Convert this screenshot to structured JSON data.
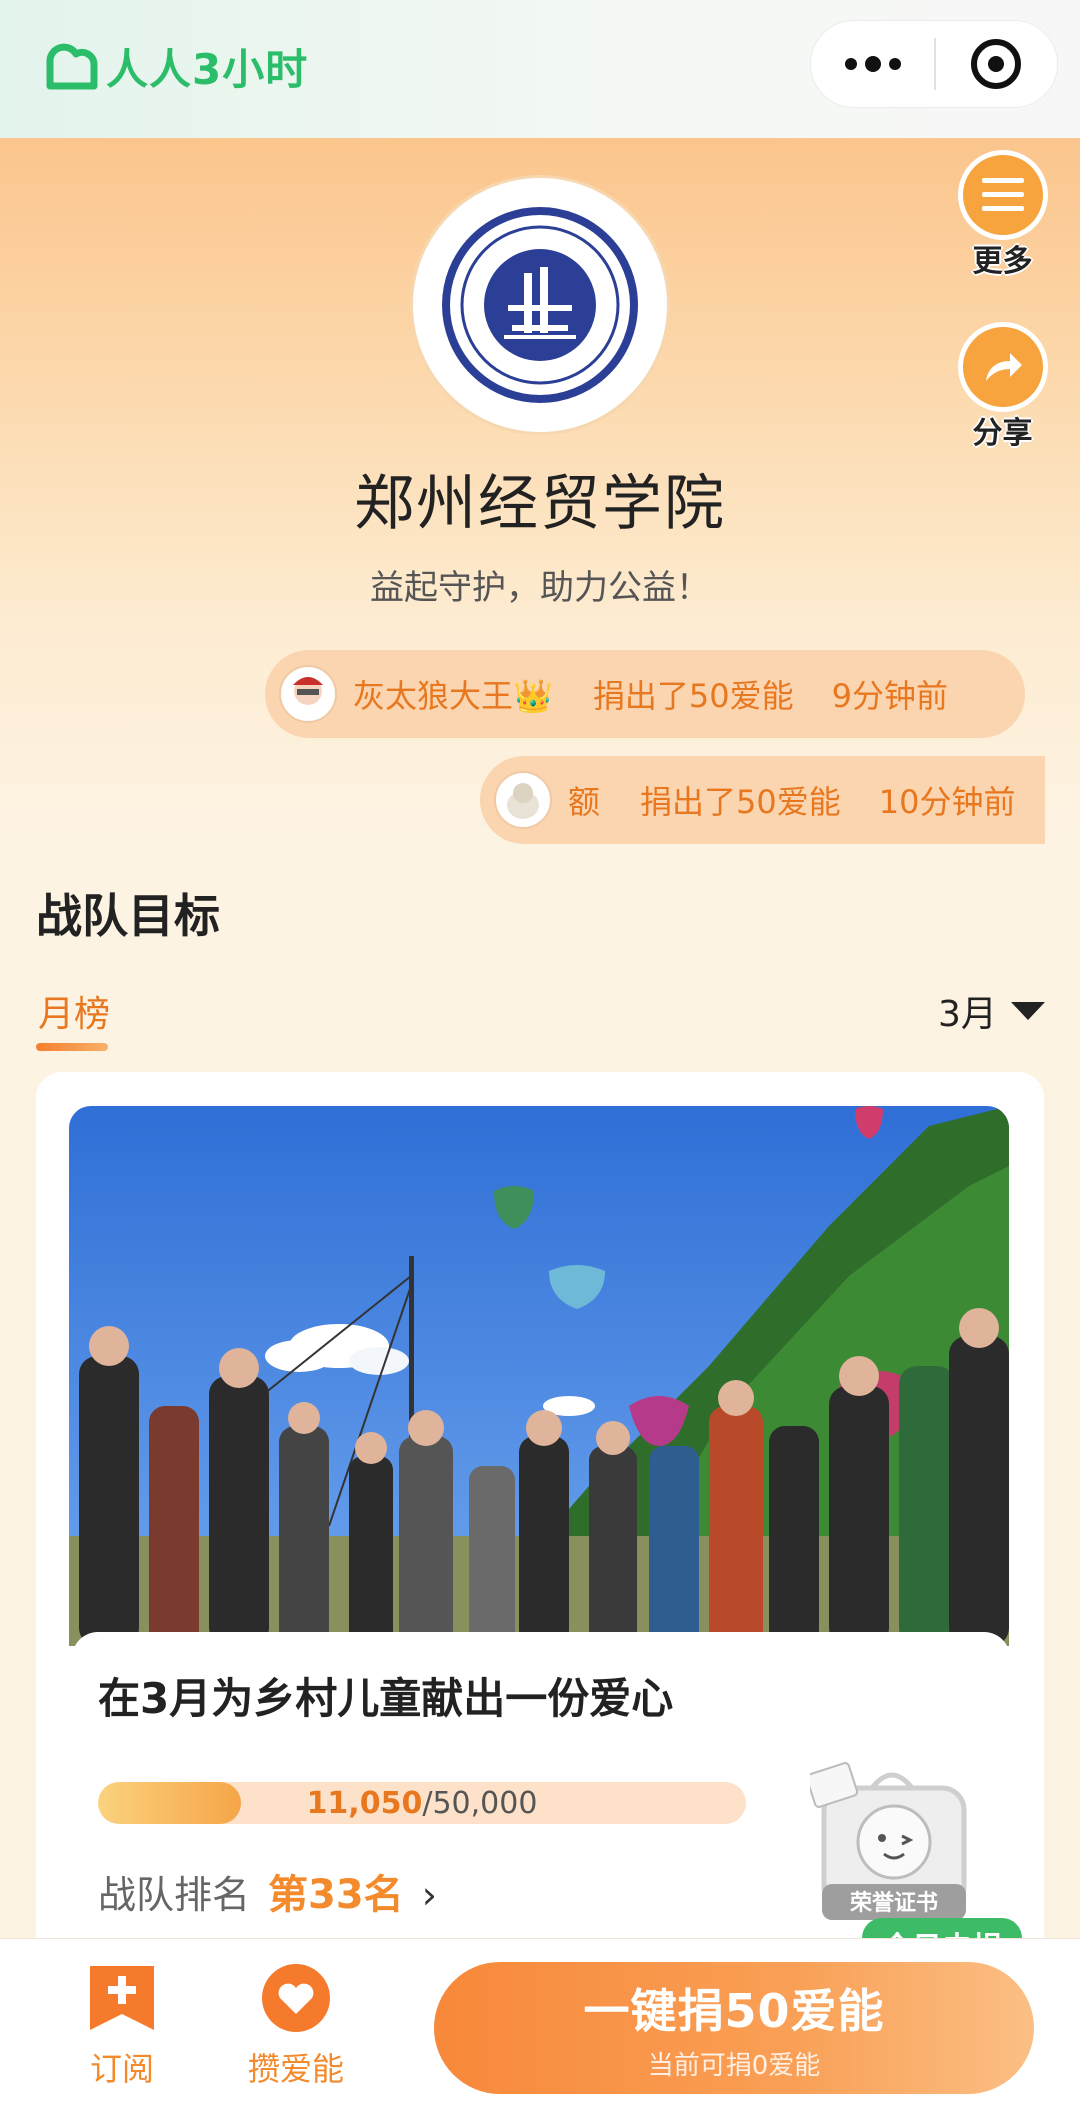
{
  "app": {
    "brand": "人人3小时",
    "brand_color": "#2bbd6a"
  },
  "capsule": {
    "more_icon": "more-dots-icon",
    "close_icon": "target-close-icon"
  },
  "team": {
    "name": "郑州经贸学院",
    "slogan": "益起守护，助力公益！",
    "emblem_icon": "university-emblem-icon"
  },
  "side_actions": [
    {
      "label": "更多",
      "icon": "menu-lines-icon"
    },
    {
      "label": "分享",
      "icon": "share-arrow-icon"
    }
  ],
  "donations": [
    {
      "user": "灰太狼大王👑",
      "action": "捐出了50爱能",
      "time": "9分钟前"
    },
    {
      "user": "额",
      "action": "捐出了50爱能",
      "time": "10分钟前"
    }
  ],
  "section": {
    "title": "战队目标"
  },
  "tabs": {
    "active": "月榜",
    "month": "3月"
  },
  "goal": {
    "title": "在3月为乡村儿童献出一份爱心",
    "current": "11,050",
    "target": "/50,000",
    "progress_fraction": 0.221,
    "rank_label": "战队排名",
    "rank_value": "第33名",
    "certificate_text": "荣誉证书",
    "status_badge": "今日未捐"
  },
  "bottom": {
    "subscribe": "订阅",
    "collect": "攒爱能",
    "donate_main": "一键捐50爱能",
    "donate_sub": "当前可捐0爱能"
  },
  "colors": {
    "accent_orange": "#f38a2b",
    "badge_green": "#3dbb67"
  }
}
